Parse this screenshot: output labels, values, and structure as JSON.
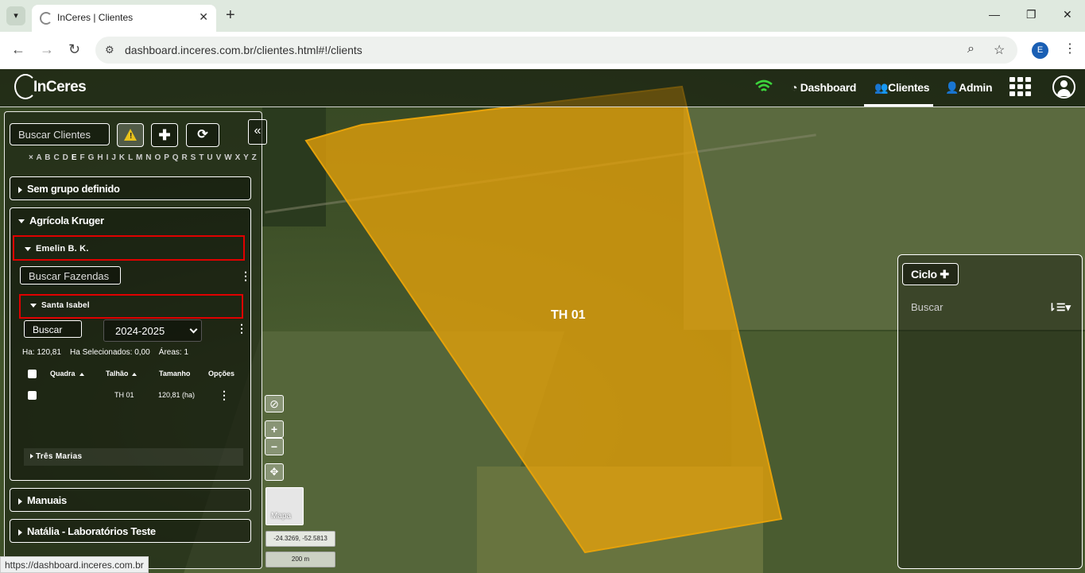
{
  "browser": {
    "tab_title": "InCeres | Clientes",
    "url": "dashboard.inceres.com.br/clientes.html#!/clients",
    "status_url": "https://dashboard.inceres.com.br",
    "profile_initial": "E"
  },
  "topnav": {
    "logo": "InCeres",
    "items": [
      "Dashboard",
      "Clientes",
      "Admin"
    ],
    "active": "Clientes"
  },
  "left": {
    "search_placeholder": "Buscar Clientes",
    "alphabet_before": "× A B C D ",
    "alphabet_selected": "E",
    "alphabet_after": " F G H I J K L M N O P Q R S T U V W X Y Z",
    "groups": {
      "g1": "Sem grupo definido",
      "g2": "Agrícola Kruger",
      "g3": "Manuais",
      "g4": "Natália - Laboratórios Teste"
    },
    "client": "Emelin B. K.",
    "search_farms": "Buscar Fazendas",
    "farm": "Santa Isabel",
    "search": "Buscar",
    "season": "2024-2025",
    "stats": "Ha: 120,81    Ha Selecionados: 0,00    Áreas: 1",
    "table": {
      "headers": [
        "Quadra",
        "Talhão",
        "Tamanho",
        "Opções"
      ],
      "rows": [
        {
          "quadra": "",
          "talhao": "TH 01",
          "tamanho": "120,81 (ha)"
        }
      ]
    },
    "farm2": "Três Marias"
  },
  "map": {
    "polygon_label": "TH 01",
    "thumb_label": "Mapa",
    "coords": "-24.3269, -52.5813",
    "scale": "200 m"
  },
  "right": {
    "ciclo": "Ciclo",
    "search": "Buscar"
  },
  "colors": {
    "polygon": "#e6a20a",
    "highlight": "#e00000"
  }
}
